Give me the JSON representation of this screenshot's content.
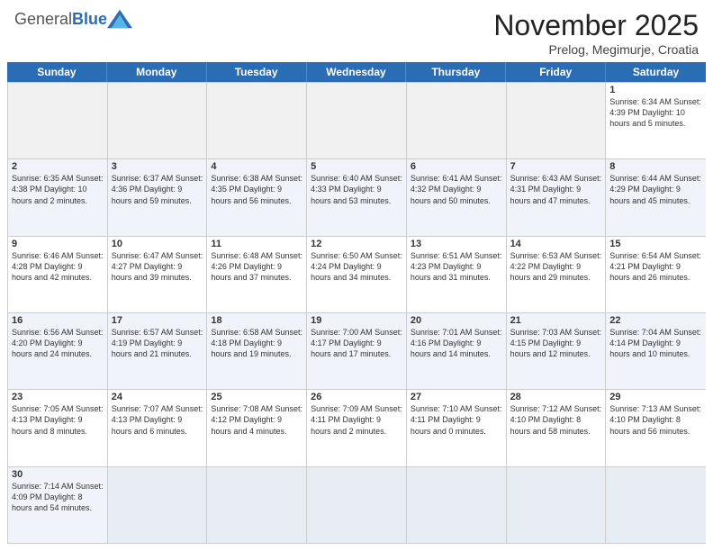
{
  "header": {
    "logo_general": "General",
    "logo_blue": "Blue",
    "month_title": "November 2025",
    "subtitle": "Prelog, Megimurje, Croatia"
  },
  "day_headers": [
    "Sunday",
    "Monday",
    "Tuesday",
    "Wednesday",
    "Thursday",
    "Friday",
    "Saturday"
  ],
  "weeks": [
    [
      {
        "num": "",
        "info": "",
        "empty": true
      },
      {
        "num": "",
        "info": "",
        "empty": true
      },
      {
        "num": "",
        "info": "",
        "empty": true
      },
      {
        "num": "",
        "info": "",
        "empty": true
      },
      {
        "num": "",
        "info": "",
        "empty": true
      },
      {
        "num": "",
        "info": "",
        "empty": true
      },
      {
        "num": "1",
        "info": "Sunrise: 6:34 AM\nSunset: 4:39 PM\nDaylight: 10 hours\nand 5 minutes.",
        "empty": false
      }
    ],
    [
      {
        "num": "2",
        "info": "Sunrise: 6:35 AM\nSunset: 4:38 PM\nDaylight: 10 hours\nand 2 minutes.",
        "empty": false
      },
      {
        "num": "3",
        "info": "Sunrise: 6:37 AM\nSunset: 4:36 PM\nDaylight: 9 hours\nand 59 minutes.",
        "empty": false
      },
      {
        "num": "4",
        "info": "Sunrise: 6:38 AM\nSunset: 4:35 PM\nDaylight: 9 hours\nand 56 minutes.",
        "empty": false
      },
      {
        "num": "5",
        "info": "Sunrise: 6:40 AM\nSunset: 4:33 PM\nDaylight: 9 hours\nand 53 minutes.",
        "empty": false
      },
      {
        "num": "6",
        "info": "Sunrise: 6:41 AM\nSunset: 4:32 PM\nDaylight: 9 hours\nand 50 minutes.",
        "empty": false
      },
      {
        "num": "7",
        "info": "Sunrise: 6:43 AM\nSunset: 4:31 PM\nDaylight: 9 hours\nand 47 minutes.",
        "empty": false
      },
      {
        "num": "8",
        "info": "Sunrise: 6:44 AM\nSunset: 4:29 PM\nDaylight: 9 hours\nand 45 minutes.",
        "empty": false
      }
    ],
    [
      {
        "num": "9",
        "info": "Sunrise: 6:46 AM\nSunset: 4:28 PM\nDaylight: 9 hours\nand 42 minutes.",
        "empty": false
      },
      {
        "num": "10",
        "info": "Sunrise: 6:47 AM\nSunset: 4:27 PM\nDaylight: 9 hours\nand 39 minutes.",
        "empty": false
      },
      {
        "num": "11",
        "info": "Sunrise: 6:48 AM\nSunset: 4:26 PM\nDaylight: 9 hours\nand 37 minutes.",
        "empty": false
      },
      {
        "num": "12",
        "info": "Sunrise: 6:50 AM\nSunset: 4:24 PM\nDaylight: 9 hours\nand 34 minutes.",
        "empty": false
      },
      {
        "num": "13",
        "info": "Sunrise: 6:51 AM\nSunset: 4:23 PM\nDaylight: 9 hours\nand 31 minutes.",
        "empty": false
      },
      {
        "num": "14",
        "info": "Sunrise: 6:53 AM\nSunset: 4:22 PM\nDaylight: 9 hours\nand 29 minutes.",
        "empty": false
      },
      {
        "num": "15",
        "info": "Sunrise: 6:54 AM\nSunset: 4:21 PM\nDaylight: 9 hours\nand 26 minutes.",
        "empty": false
      }
    ],
    [
      {
        "num": "16",
        "info": "Sunrise: 6:56 AM\nSunset: 4:20 PM\nDaylight: 9 hours\nand 24 minutes.",
        "empty": false
      },
      {
        "num": "17",
        "info": "Sunrise: 6:57 AM\nSunset: 4:19 PM\nDaylight: 9 hours\nand 21 minutes.",
        "empty": false
      },
      {
        "num": "18",
        "info": "Sunrise: 6:58 AM\nSunset: 4:18 PM\nDaylight: 9 hours\nand 19 minutes.",
        "empty": false
      },
      {
        "num": "19",
        "info": "Sunrise: 7:00 AM\nSunset: 4:17 PM\nDaylight: 9 hours\nand 17 minutes.",
        "empty": false
      },
      {
        "num": "20",
        "info": "Sunrise: 7:01 AM\nSunset: 4:16 PM\nDaylight: 9 hours\nand 14 minutes.",
        "empty": false
      },
      {
        "num": "21",
        "info": "Sunrise: 7:03 AM\nSunset: 4:15 PM\nDaylight: 9 hours\nand 12 minutes.",
        "empty": false
      },
      {
        "num": "22",
        "info": "Sunrise: 7:04 AM\nSunset: 4:14 PM\nDaylight: 9 hours\nand 10 minutes.",
        "empty": false
      }
    ],
    [
      {
        "num": "23",
        "info": "Sunrise: 7:05 AM\nSunset: 4:13 PM\nDaylight: 9 hours\nand 8 minutes.",
        "empty": false
      },
      {
        "num": "24",
        "info": "Sunrise: 7:07 AM\nSunset: 4:13 PM\nDaylight: 9 hours\nand 6 minutes.",
        "empty": false
      },
      {
        "num": "25",
        "info": "Sunrise: 7:08 AM\nSunset: 4:12 PM\nDaylight: 9 hours\nand 4 minutes.",
        "empty": false
      },
      {
        "num": "26",
        "info": "Sunrise: 7:09 AM\nSunset: 4:11 PM\nDaylight: 9 hours\nand 2 minutes.",
        "empty": false
      },
      {
        "num": "27",
        "info": "Sunrise: 7:10 AM\nSunset: 4:11 PM\nDaylight: 9 hours\nand 0 minutes.",
        "empty": false
      },
      {
        "num": "28",
        "info": "Sunrise: 7:12 AM\nSunset: 4:10 PM\nDaylight: 8 hours\nand 58 minutes.",
        "empty": false
      },
      {
        "num": "29",
        "info": "Sunrise: 7:13 AM\nSunset: 4:10 PM\nDaylight: 8 hours\nand 56 minutes.",
        "empty": false
      }
    ],
    [
      {
        "num": "30",
        "info": "Sunrise: 7:14 AM\nSunset: 4:09 PM\nDaylight: 8 hours\nand 54 minutes.",
        "empty": false
      },
      {
        "num": "",
        "info": "",
        "empty": true
      },
      {
        "num": "",
        "info": "",
        "empty": true
      },
      {
        "num": "",
        "info": "",
        "empty": true
      },
      {
        "num": "",
        "info": "",
        "empty": true
      },
      {
        "num": "",
        "info": "",
        "empty": true
      },
      {
        "num": "",
        "info": "",
        "empty": true
      }
    ]
  ]
}
